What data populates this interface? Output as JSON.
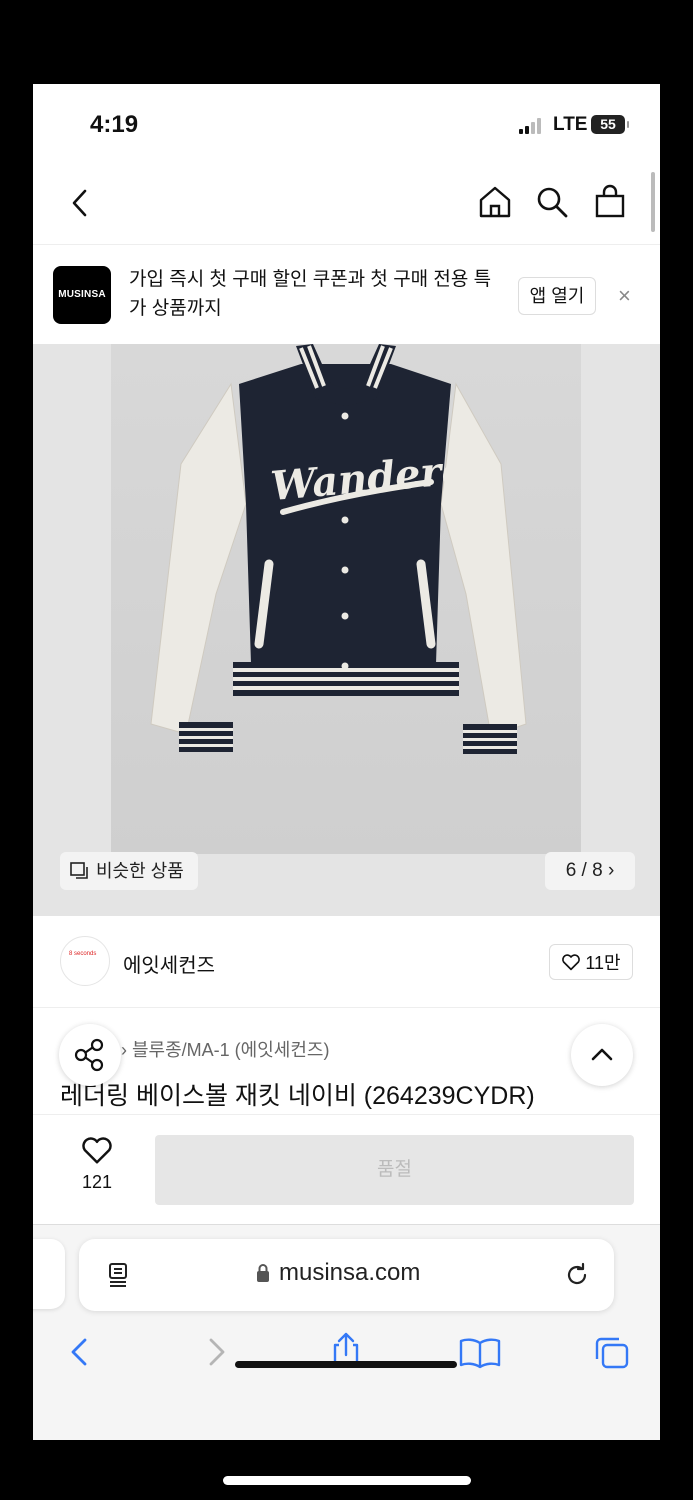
{
  "status_bar": {
    "time": "4:19",
    "network": "LTE",
    "battery": "55"
  },
  "banner": {
    "logo_text": "MUSINSA",
    "message": "가입 즉시 첫 구매 할인 쿠폰과 첫 구매 전용 특가 상품까지",
    "open_app_label": "앱 열기",
    "close_glyph": "×"
  },
  "gallery": {
    "similar_label": "비슷한 상품",
    "counter": "6 / 8 ›",
    "jacket_lettering": "Wanderer"
  },
  "brand": {
    "logo_text": "8 seconds",
    "name": "에잇세컨즈",
    "likes": "11만"
  },
  "product": {
    "breadcrumb": "› 블루종/MA-1 (에잇세컨즈)",
    "title": "레더링 베이스볼 재킷 네이비 (264239CYDR)"
  },
  "buy_bar": {
    "like_count": "121",
    "purchase_label": "품절"
  },
  "safari": {
    "url": "musinsa.com"
  },
  "colors": {
    "navy": "#1e2433",
    "cream": "#eceae4",
    "safari_blue": "#3478f6"
  }
}
